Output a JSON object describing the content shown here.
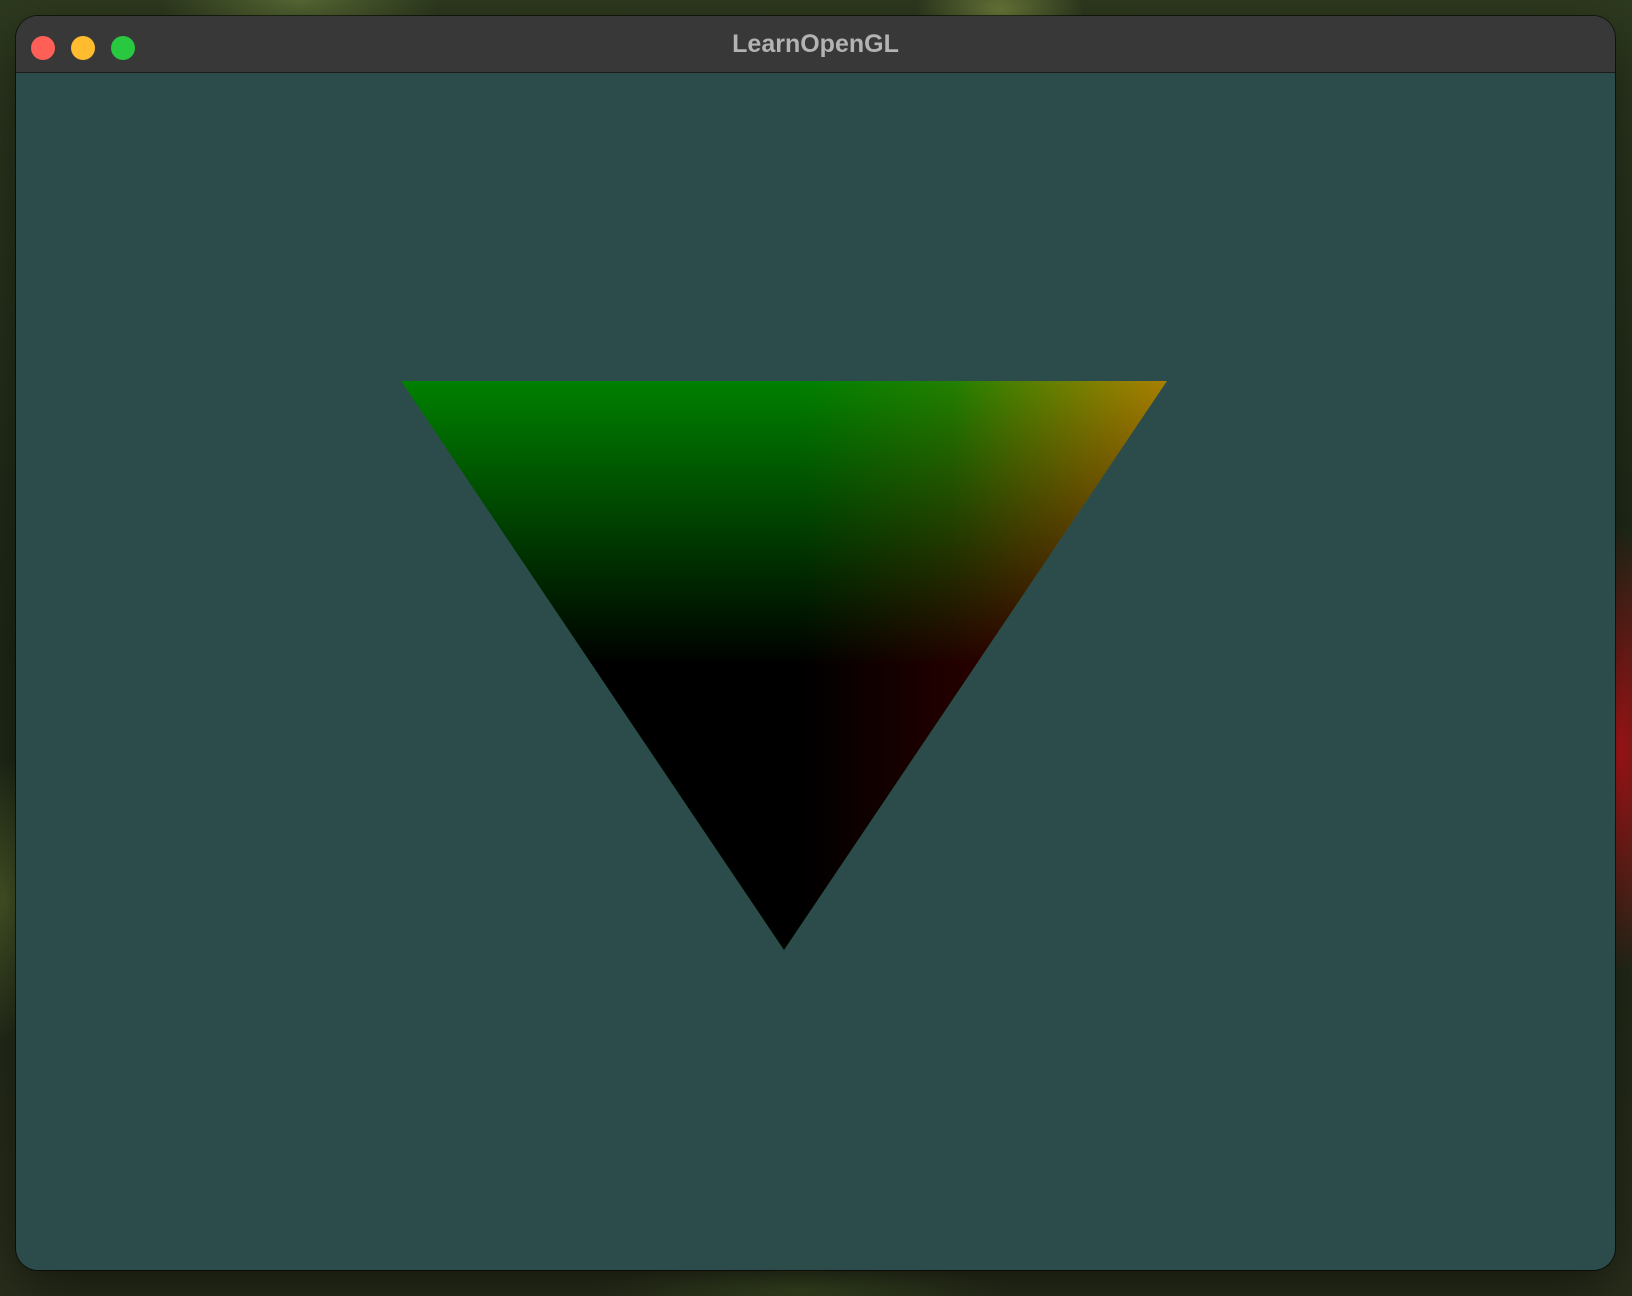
{
  "window": {
    "title": "LearnOpenGL",
    "clear_color": "#2c4c4c"
  },
  "traffic_lights": {
    "close_color": "#ff5f57",
    "minimize_color": "#febc2e",
    "maximize_color": "#28c840"
  },
  "triangle": {
    "vertex_colors": {
      "top_left": "#008000",
      "top_right": "#808000",
      "bottom": "#000000"
    }
  }
}
